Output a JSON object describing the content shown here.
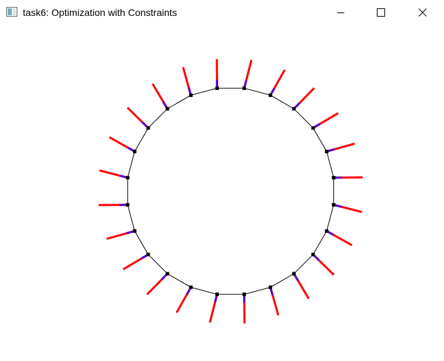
{
  "window": {
    "title": "task6: Optimization with Constraints",
    "icon": "window-app-icon",
    "controls": [
      "minimize-icon",
      "maximize-icon",
      "close-icon"
    ]
  },
  "scene": {
    "description_shape": "closed polygon ring",
    "vertex_count": 24,
    "colors": {
      "outline": "#000000",
      "vertex": "#000000",
      "force_vector": "#ff0000",
      "constraint_vector": "#5500cc"
    }
  }
}
